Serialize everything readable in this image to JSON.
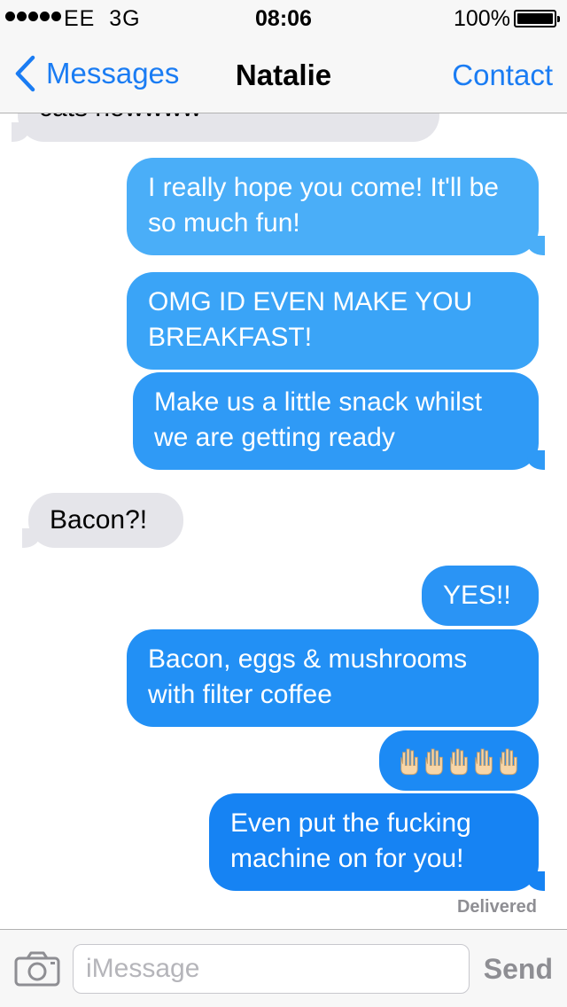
{
  "status_bar": {
    "carrier": "EE",
    "network": "3G",
    "time": "08:06",
    "battery_percent": "100%"
  },
  "nav": {
    "back_label": "Messages",
    "title": "Natalie",
    "contact_label": "Contact",
    "accent_color": "#1a7cf3"
  },
  "messages": [
    {
      "direction": "incoming",
      "text": "cats nowwww"
    },
    {
      "direction": "outgoing",
      "text": "I really hope you come! It'll be so much fun!"
    },
    {
      "direction": "outgoing",
      "text": "OMG ID EVEN MAKE YOU BREAKFAST!"
    },
    {
      "direction": "outgoing",
      "text": "Make us a little snack whilst we are getting ready"
    },
    {
      "direction": "incoming",
      "text": "Bacon?!"
    },
    {
      "direction": "outgoing",
      "text": "YES!!"
    },
    {
      "direction": "outgoing",
      "text": "Bacon, eggs & mushrooms with filter coffee"
    },
    {
      "direction": "outgoing",
      "emoji": "raised-hands-emoji",
      "count": 5
    },
    {
      "direction": "outgoing",
      "text": "Even put the fucking machine on for you!"
    }
  ],
  "delivery_status": "Delivered",
  "input": {
    "placeholder": "iMessage",
    "send_label": "Send",
    "camera_icon": "camera-icon"
  }
}
